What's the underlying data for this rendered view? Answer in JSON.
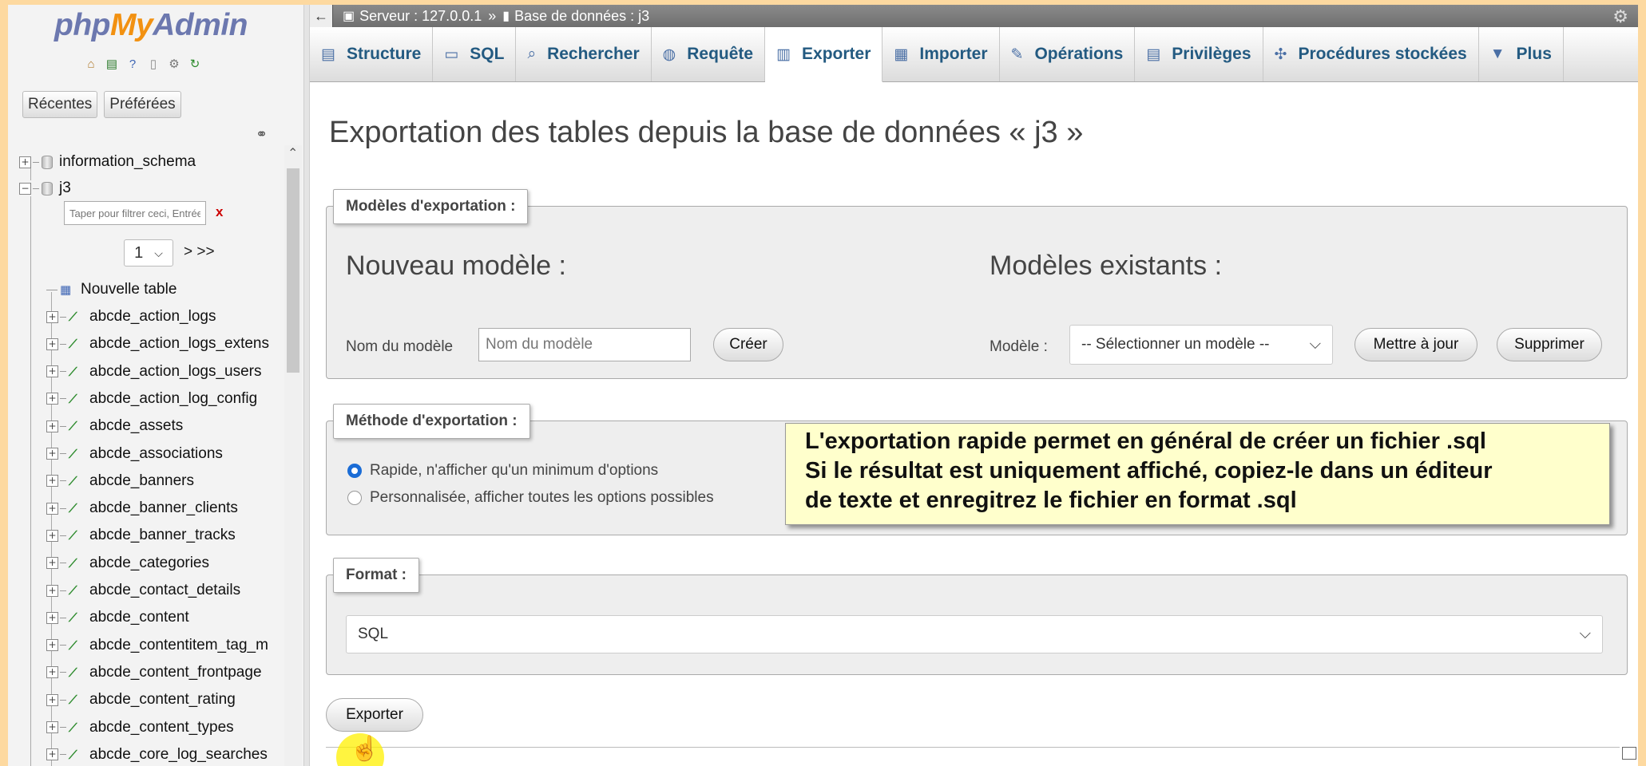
{
  "logo": {
    "part1": "php",
    "part2": "My",
    "part3": "Admin"
  },
  "nav": {
    "recent_label": "Récentes",
    "favorites_label": "Préférées",
    "databases": [
      {
        "name": "information_schema"
      },
      {
        "name": "j3"
      }
    ],
    "filter_placeholder": "Taper pour filtrer ceci, Entrée pour chercher dans toutes",
    "filter_clear": "x",
    "page_value": "1",
    "page_next": "> >>",
    "new_table_label": "Nouvelle table",
    "tables": [
      "abcde_action_logs",
      "abcde_action_logs_extens",
      "abcde_action_logs_users",
      "abcde_action_log_config",
      "abcde_assets",
      "abcde_associations",
      "abcde_banners",
      "abcde_banner_clients",
      "abcde_banner_tracks",
      "abcde_categories",
      "abcde_contact_details",
      "abcde_content",
      "abcde_contentitem_tag_m",
      "abcde_content_frontpage",
      "abcde_content_rating",
      "abcde_content_types",
      "abcde_core_log_searches"
    ]
  },
  "breadcrumb": {
    "server": "Serveur : 127.0.0.1",
    "separator": "»",
    "database": "Base de données : j3"
  },
  "tabs": [
    {
      "label": "Structure",
      "icon": "structure-icon",
      "active": false
    },
    {
      "label": "SQL",
      "icon": "sql-icon",
      "active": false
    },
    {
      "label": "Rechercher",
      "icon": "search-icon",
      "active": false
    },
    {
      "label": "Requête",
      "icon": "query-icon",
      "active": false
    },
    {
      "label": "Exporter",
      "icon": "export-icon",
      "active": true
    },
    {
      "label": "Importer",
      "icon": "import-icon",
      "active": false
    },
    {
      "label": "Opérations",
      "icon": "wrench-icon",
      "active": false
    },
    {
      "label": "Privilèges",
      "icon": "privileges-icon",
      "active": false
    },
    {
      "label": "Procédures stockées",
      "icon": "routines-icon",
      "active": false
    },
    {
      "label": "Plus",
      "icon": "triangle-down-icon",
      "active": false
    }
  ],
  "main": {
    "title": "Exportation des tables depuis la base de données « j3 »",
    "templates": {
      "legend": "Modèles d'exportation :",
      "new_heading": "Nouveau modèle :",
      "existing_heading": "Modèles existants :",
      "name_label": "Nom du modèle",
      "name_placeholder": "Nom du modèle",
      "create_button": "Créer",
      "template_label": "Modèle :",
      "template_select": "-- Sélectionner un modèle --",
      "update_button": "Mettre à jour",
      "delete_button": "Supprimer"
    },
    "method": {
      "legend": "Méthode d'exportation :",
      "quick_label": "Rapide, n'afficher qu'un minimum d'options",
      "custom_label": "Personnalisée, afficher toutes les options possibles",
      "selected": "quick"
    },
    "format": {
      "legend": "Format :",
      "value": "SQL"
    },
    "export_button": "Exporter"
  },
  "tooltip": {
    "line1": "L'exportation rapide permet en général de créer un fichier .sql",
    "line2": "Si le résultat est uniquement affiché, copiez-le dans un éditeur",
    "line3": "de texte et enregitrez le fichier en format .sql"
  },
  "colors": {
    "page_background": "#FDD9A0",
    "logo_blue": "#6C78AF",
    "logo_orange": "#F29111",
    "tab_text": "#235a81",
    "tooltip_background": "#FFFFCC",
    "radio_selected": "#1a6cd6"
  }
}
